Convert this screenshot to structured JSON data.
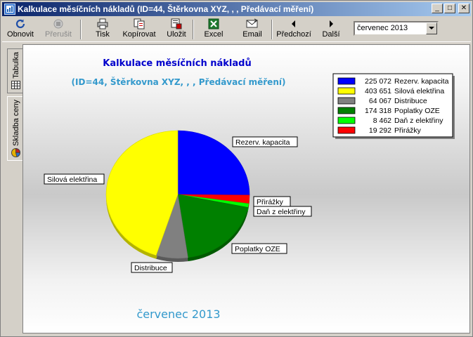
{
  "window": {
    "title": "Kalkulace měsíčních nákladů (ID=44, Štěrkovna XYZ, , , Předávací měření)",
    "controls": {
      "minimize": "_",
      "maximize": "□",
      "close": "✕"
    }
  },
  "toolbar": {
    "refresh": "Obnovit",
    "stop": "Přerušit",
    "print": "Tisk",
    "copy": "Kopírovat",
    "save": "Uložit",
    "excel": "Excel",
    "email": "Email",
    "previous": "Předchozí",
    "next": "Další",
    "month": "červenec 2013"
  },
  "tabs": {
    "table": "Tabulka",
    "price_composition": "Skladba ceny"
  },
  "colors": {
    "rezerv": "#0000ff",
    "silova": "#ffff00",
    "distribuce": "#808080",
    "oze": "#008000",
    "dan": "#00ff00",
    "prirazky": "#ff0000",
    "title_blue": "#0000cc",
    "subtitle_blue": "#3399cc"
  },
  "chart_data": {
    "type": "pie",
    "title": "Kalkulace měsíčních nákladů",
    "subtitle": "(ID=44, Štěrkovna XYZ, , , Předávací měření)",
    "footer": "červenec 2013",
    "legend_position": "top-right",
    "slices": [
      {
        "label": "Rezerv. kapacita",
        "value": 225072,
        "value_text": "225 072",
        "color": "#0000ff"
      },
      {
        "label": "Přirážky",
        "value": 19292,
        "value_text": "19 292",
        "color": "#ff0000"
      },
      {
        "label": "Daň z elektřiny",
        "value": 8462,
        "value_text": "8 462",
        "color": "#00ff00"
      },
      {
        "label": "Poplatky OZE",
        "value": 174318,
        "value_text": "174 318",
        "color": "#008000"
      },
      {
        "label": "Distribuce",
        "value": 64067,
        "value_text": "64 067",
        "color": "#808080"
      },
      {
        "label": "Silová elektřina",
        "value": 403651,
        "value_text": "403 651",
        "color": "#ffff00"
      }
    ],
    "legend": [
      {
        "value_text": "225 072",
        "label": "Rezerv. kapacita",
        "color": "#0000ff"
      },
      {
        "value_text": "403 651",
        "label": "Silová elektřina",
        "color": "#ffff00"
      },
      {
        "value_text": "64 067",
        "label": "Distribuce",
        "color": "#808080"
      },
      {
        "value_text": "174 318",
        "label": "Poplatky OZE",
        "color": "#008000"
      },
      {
        "value_text": "8 462",
        "label": "Daň z elektřiny",
        "color": "#00ff00"
      },
      {
        "value_text": "19 292",
        "label": "Přirážky",
        "color": "#ff0000"
      }
    ]
  }
}
